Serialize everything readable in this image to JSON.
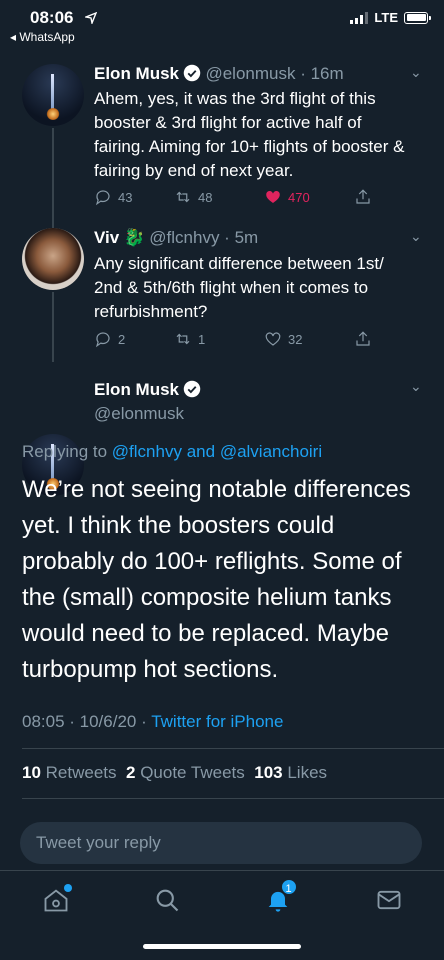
{
  "status_bar": {
    "time": "08:06",
    "back_app": "◂ WhatsApp",
    "network": "LTE"
  },
  "tweets": [
    {
      "name": "Elon Musk",
      "handle": "@elonmusk · 16m",
      "text": "Ahem, yes, it was the 3rd flight of this booster & 3rd flight for active half of fairing. Aiming for 10+ flights of booster & fairing by end of next year.",
      "replies": "43",
      "retweets": "48",
      "likes": "470"
    },
    {
      "name": "Viv",
      "handle": "@flcnhvy · 5m",
      "text": "Any significant difference between 1st/ 2nd & 5th/6th flight when it comes to refurbishment?",
      "replies": "2",
      "retweets": "1",
      "likes": "32"
    }
  ],
  "main_tweet": {
    "name": "Elon Musk",
    "handle": "@elonmusk",
    "replying_prefix": "Replying to",
    "replying_user1": "@flcnhvy",
    "replying_and": "and",
    "replying_user2": "@alvianchoiri",
    "text": "We’re not seeing notable differences yet. I think the boosters could probably do 100+ reflights. Some of the (small) composite helium tanks would need to be replaced. Maybe turbopump hot sections.",
    "timestamp": "08:05 · 10/6/20 ·",
    "source": "Twitter for iPhone",
    "retweets_count": "10",
    "retweets_label": "Retweets",
    "quotes_count": "2",
    "quotes_label": "Quote Tweets",
    "likes_count": "103",
    "likes_label": "Likes"
  },
  "reply_box": {
    "placeholder": "Tweet your reply"
  },
  "tabbar": {
    "notification_count": "1"
  },
  "colors": {
    "background": "#15202b",
    "accent": "#1da1f2",
    "like": "#e0245e",
    "muted": "#8899a6"
  }
}
